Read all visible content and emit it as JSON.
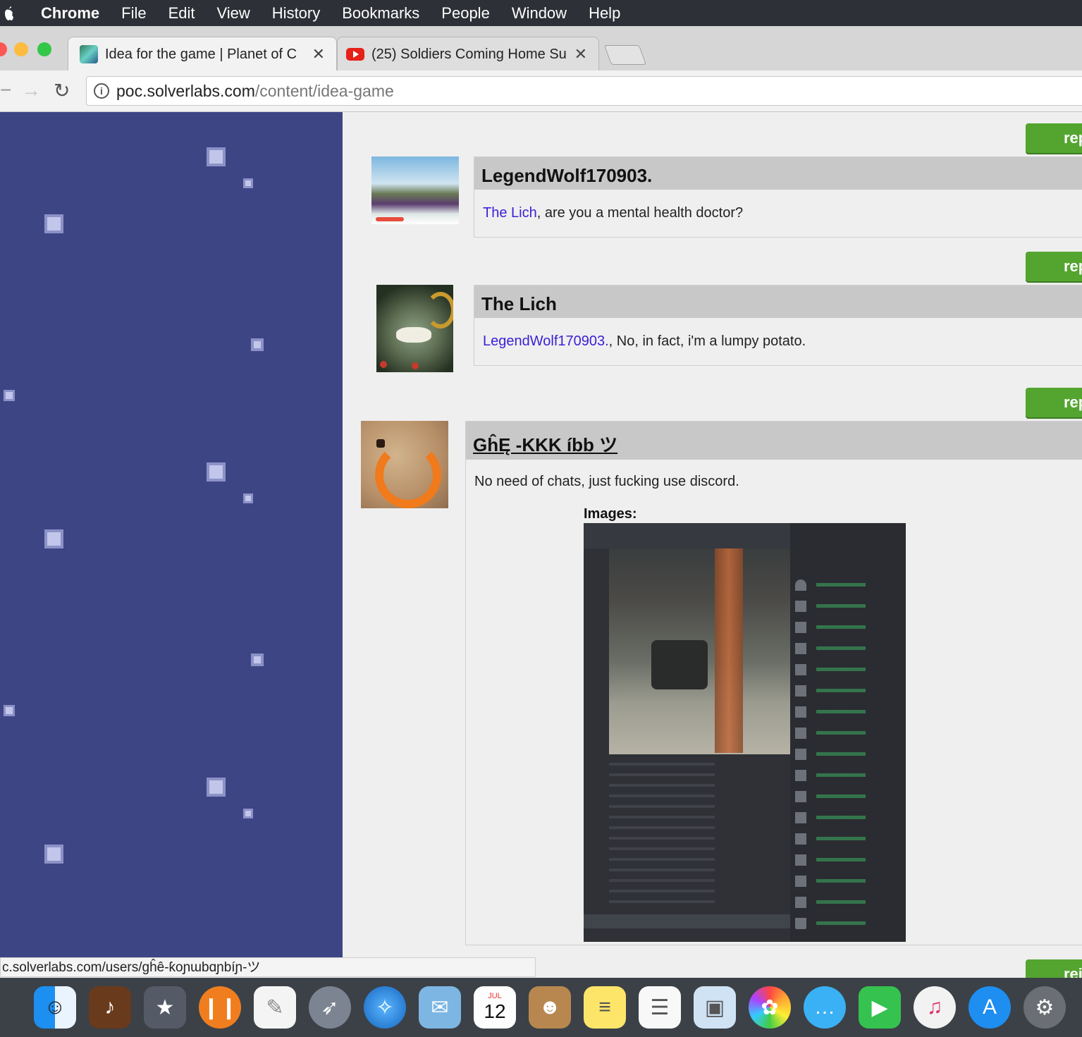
{
  "menubar": {
    "app": "Chrome",
    "items": [
      "File",
      "Edit",
      "View",
      "History",
      "Bookmarks",
      "People",
      "Window",
      "Help"
    ]
  },
  "tabs": [
    {
      "title": "Idea for the game | Planet of C",
      "icon": "planet-favicon",
      "close": "✕"
    },
    {
      "title": "(25) Soldiers Coming Home Su",
      "icon": "youtube-favicon",
      "close": "✕"
    }
  ],
  "address": {
    "host": "poc.solverlabs.com",
    "path": "/content/idea-game"
  },
  "comments": [
    {
      "author": "LegendWolf170903.",
      "mention": "The Lich",
      "text": ", are you a mental health doctor?"
    },
    {
      "author": "The Lich",
      "mention": "LegendWolf170903.",
      "text": ", No, in fact, i'm a lumpy potato."
    },
    {
      "author": "GĥĘ -KKK íbb ツ",
      "text": "No need of chats, just fucking use discord.",
      "images_label": "Images:"
    }
  ],
  "reply_label": "rep",
  "reply_label_last": "rei",
  "status_url": "c.solverlabs.com/users/gĥê-ƙoɲɯbɑɲbíɲ-ツ",
  "dock": {
    "icons": [
      "finder-icon",
      "garageband-icon",
      "imovie-icon",
      "ibooks-icon",
      "textedit-icon",
      "launchpad-icon",
      "safari-icon",
      "mail-icon",
      "calendar-icon",
      "contacts-icon",
      "notes-icon",
      "reminders-icon",
      "preview-icon",
      "photos-icon",
      "messages-icon",
      "facetime-icon",
      "itunes-icon",
      "appstore-icon",
      "system-preferences-icon"
    ],
    "calendar_month": "JUL",
    "calendar_day": "12"
  },
  "colors": {
    "sidebar": "#3d4585",
    "reply_button": "#53a52f",
    "mention": "#3a1fd6"
  }
}
